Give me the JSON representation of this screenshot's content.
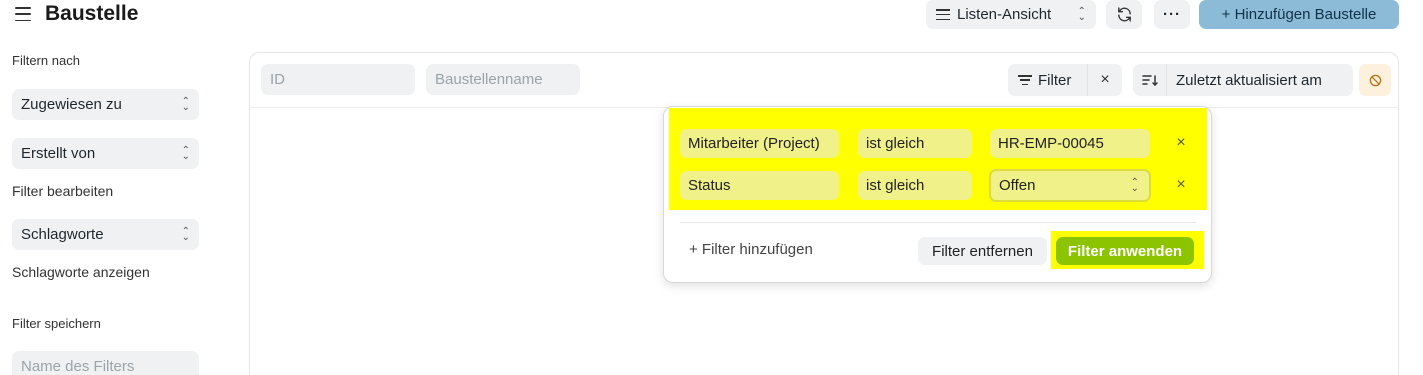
{
  "header": {
    "title": "Baustelle",
    "view_label": "Listen-Ansicht",
    "more_label": "···",
    "add_label": "+ Hinzufügen Baustelle"
  },
  "sidebar": {
    "filter_by_label": "Filtern nach",
    "assigned_to": "Zugewiesen zu",
    "created_by": "Erstellt von",
    "edit_filters": "Filter bearbeiten",
    "tags": "Schlagworte",
    "show_tags": "Schlagworte anzeigen",
    "save_filter_label": "Filter speichern",
    "filter_name_placeholder": "Name des Filters"
  },
  "list_toolbar": {
    "id_placeholder": "ID",
    "name_placeholder": "Baustellenname",
    "filter_label": "Filter",
    "sort_label": "Zuletzt aktualisiert am"
  },
  "filter_popover": {
    "rows": [
      {
        "field": "Mitarbeiter (Project)",
        "operator": "ist gleich",
        "value": "HR-EMP-00045"
      },
      {
        "field": "Status",
        "operator": "ist gleich",
        "value": "Offen"
      }
    ],
    "add_filter_label": "+ Filter hinzufügen",
    "remove_filters_label": "Filter entfernen",
    "apply_filters_label": "Filter anwenden"
  },
  "colors": {
    "highlight": "#ffff00",
    "apply_button": "#8cc400",
    "add_button": "#8bbbd7"
  }
}
